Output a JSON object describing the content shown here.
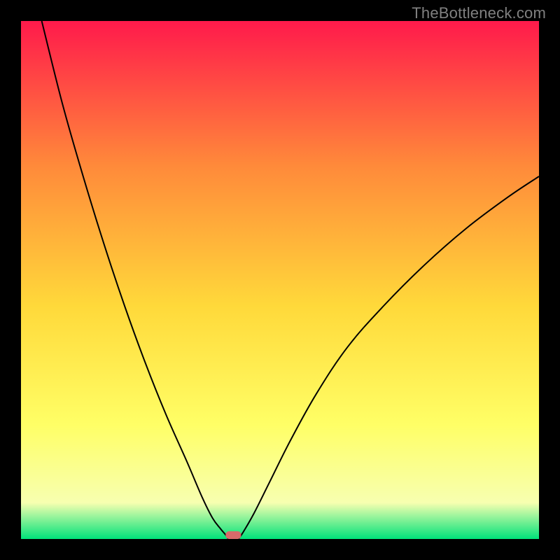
{
  "watermark": "TheBottleneck.com",
  "chart_data": {
    "type": "line",
    "title": "",
    "xlabel": "",
    "ylabel": "",
    "xlim": [
      0,
      100
    ],
    "ylim": [
      0,
      100
    ],
    "grid": false,
    "background_gradient": {
      "top": "#ff1a4b",
      "mid_upper": "#ff8a3a",
      "mid": "#ffd93a",
      "mid_lower": "#ffff66",
      "near_bottom": "#f7ffb0",
      "bottom": "#00e27a"
    },
    "series": [
      {
        "name": "left-curve",
        "x": [
          4,
          8,
          12,
          16,
          20,
          24,
          28,
          32,
          35,
          37,
          38.5,
          39.5,
          40
        ],
        "y": [
          100,
          84,
          70,
          57,
          45,
          34,
          24,
          15,
          8,
          4,
          2,
          0.8,
          0
        ],
        "stroke": "#000000",
        "stroke_width": 2
      },
      {
        "name": "right-curve",
        "x": [
          42,
          43,
          45,
          48,
          52,
          57,
          63,
          70,
          78,
          86,
          94,
          100
        ],
        "y": [
          0,
          1.5,
          5,
          11,
          19,
          28,
          37,
          45,
          53,
          60,
          66,
          70
        ],
        "stroke": "#000000",
        "stroke_width": 2
      }
    ],
    "marker": {
      "name": "optimum-marker",
      "x": 41,
      "y": 0,
      "width": 3,
      "height": 1.5,
      "fill": "#d86a6a",
      "rx": 5
    }
  }
}
